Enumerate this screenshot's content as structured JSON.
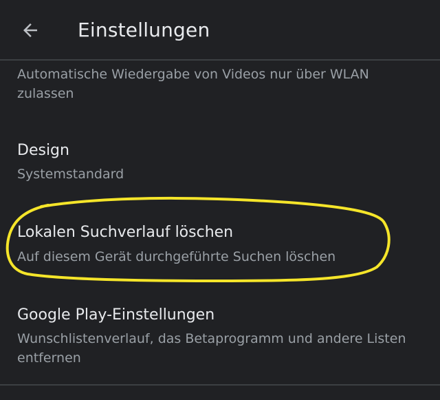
{
  "header": {
    "title": "Einstellungen",
    "back_icon": "arrow-left-icon"
  },
  "settings": [
    {
      "subtitle": "Automatische Wiedergabe von Videos nur über WLAN zulassen"
    },
    {
      "title": "Design",
      "subtitle": "Systemstandard"
    },
    {
      "title": "Lokalen Suchverlauf löschen",
      "subtitle": "Auf diesem Gerät durchgeführte Suchen löschen"
    },
    {
      "title": "Google Play-Einstellungen",
      "subtitle": "Wunschlistenverlauf, das Betaprogramm und andere Listen entfernen"
    }
  ],
  "colors": {
    "background": "#202124",
    "title_text": "#e8eaed",
    "subtitle_text": "#9aa0a6",
    "divider": "#3c4043",
    "highlight": "#f5e52a"
  }
}
